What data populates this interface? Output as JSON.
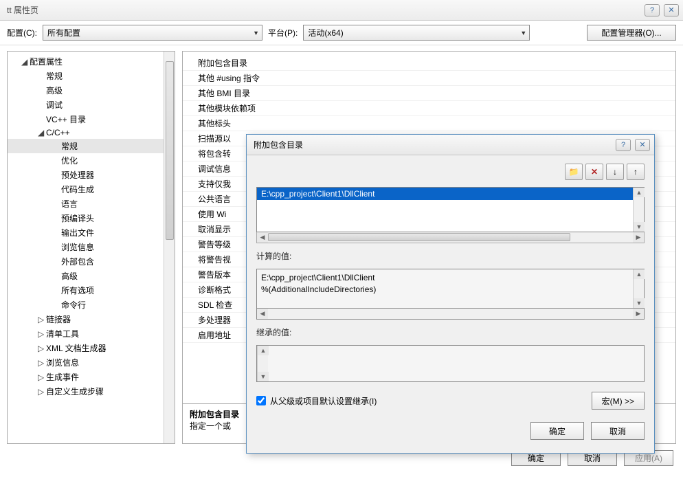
{
  "window": {
    "title": "tt 属性页"
  },
  "config": {
    "label": "配置(C):",
    "value": "所有配置",
    "platform_label": "平台(P):",
    "platform_value": "活动(x64)",
    "manager_btn": "配置管理器(O)..."
  },
  "tree": [
    {
      "label": "配置属性",
      "level": 1,
      "expand": "down"
    },
    {
      "label": "常规",
      "level": 2
    },
    {
      "label": "高级",
      "level": 2
    },
    {
      "label": "调试",
      "level": 2
    },
    {
      "label": "VC++ 目录",
      "level": 2
    },
    {
      "label": "C/C++",
      "level": 2,
      "expand": "down"
    },
    {
      "label": "常规",
      "level": 3,
      "selected": true
    },
    {
      "label": "优化",
      "level": 3
    },
    {
      "label": "预处理器",
      "level": 3
    },
    {
      "label": "代码生成",
      "level": 3
    },
    {
      "label": "语言",
      "level": 3
    },
    {
      "label": "预编译头",
      "level": 3
    },
    {
      "label": "输出文件",
      "level": 3
    },
    {
      "label": "浏览信息",
      "level": 3
    },
    {
      "label": "外部包含",
      "level": 3
    },
    {
      "label": "高级",
      "level": 3
    },
    {
      "label": "所有选项",
      "level": 3
    },
    {
      "label": "命令行",
      "level": 3
    },
    {
      "label": "链接器",
      "level": 2,
      "expand": "right"
    },
    {
      "label": "清单工具",
      "level": 2,
      "expand": "right"
    },
    {
      "label": "XML 文档生成器",
      "level": 2,
      "expand": "right"
    },
    {
      "label": "浏览信息",
      "level": 2,
      "expand": "right"
    },
    {
      "label": "生成事件",
      "level": 2,
      "expand": "right"
    },
    {
      "label": "自定义生成步骤",
      "level": 2,
      "expand": "right"
    }
  ],
  "props": [
    "附加包含目录",
    "其他 #using 指令",
    "其他 BMI 目录",
    "其他模块依赖项",
    "其他标头",
    "扫描源以",
    "将包含转",
    "调试信息",
    "支持仅我",
    "公共语言",
    "使用 Wi",
    "取消显示",
    "警告等级",
    "将警告视",
    "警告版本",
    "诊断格式",
    "SDL 检查",
    "多处理器",
    "启用地址"
  ],
  "desc": {
    "title": "附加包含目录",
    "body": "指定一个或"
  },
  "buttons": {
    "ok": "确定",
    "cancel": "取消",
    "apply": "应用(A)"
  },
  "dialog": {
    "title": "附加包含目录",
    "path": "E:\\cpp_project\\Client1\\DllClient",
    "computed_label": "计算的值:",
    "computed1": "E:\\cpp_project\\Client1\\DllClient",
    "computed2": "%(AdditionalIncludeDirectories)",
    "inherited_label": "继承的值:",
    "inherit_chk": "从父级或项目默认设置继承(I)",
    "macro_btn": "宏(M) >>",
    "ok": "确定",
    "cancel": "取消"
  }
}
